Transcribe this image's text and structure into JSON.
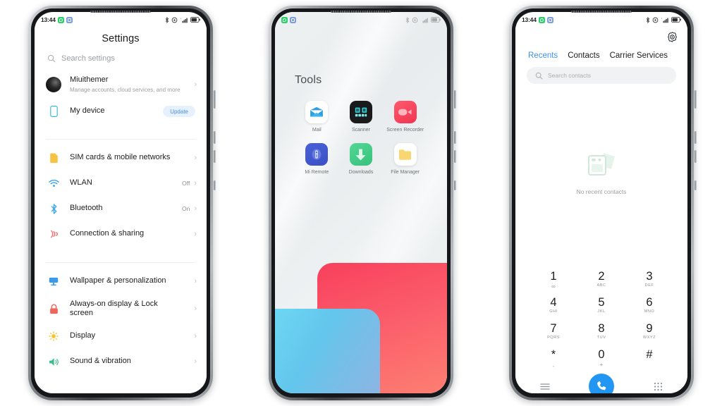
{
  "meta": {
    "accent_blue": "#3f90e8",
    "call_button_color": "#2196f3",
    "update_badge_color": "#4a90d9"
  },
  "status_bar": {
    "time": "13:44",
    "left_icons": [
      "whatsapp-icon",
      "blue-app-icon"
    ],
    "right_icons": [
      "bluetooth-icon",
      "alarm-icon",
      "signal-icon",
      "battery-icon"
    ]
  },
  "phone1_settings": {
    "title": "Settings",
    "search": {
      "placeholder": "Search settings",
      "icon": "search-icon"
    },
    "account": {
      "name": "Miuithemer",
      "subtitle": "Manage accounts, cloud services, and more",
      "avatar": "avatar"
    },
    "device": {
      "label": "My device",
      "badge": "Update",
      "icon": "phone-outline-icon"
    },
    "group_network": [
      {
        "label": "SIM cards & mobile networks",
        "value": "",
        "icon": "sim-card-icon"
      },
      {
        "label": "WLAN",
        "value": "Off",
        "icon": "wifi-icon"
      },
      {
        "label": "Bluetooth",
        "value": "On",
        "icon": "bluetooth-icon"
      },
      {
        "label": "Connection & sharing",
        "value": "",
        "icon": "connection-sharing-icon"
      }
    ],
    "group_personal": [
      {
        "label": "Wallpaper & personalization",
        "value": "",
        "icon": "wallpaper-icon"
      },
      {
        "label": "Always-on display & Lock screen",
        "value": "",
        "icon": "lock-icon"
      },
      {
        "label": "Display",
        "value": "",
        "icon": "brightness-icon"
      },
      {
        "label": "Sound & vibration",
        "value": "",
        "icon": "speaker-icon"
      }
    ],
    "chevron": "›"
  },
  "phone2_home": {
    "folder_title": "Tools",
    "apps": [
      {
        "name": "Mail",
        "icon": "mail-icon"
      },
      {
        "name": "Scanner",
        "icon": "scanner-icon"
      },
      {
        "name": "Screen Recorder",
        "icon": "screen-recorder-icon"
      },
      {
        "name": "Mi Remote",
        "icon": "mi-remote-icon"
      },
      {
        "name": "Downloads",
        "icon": "downloads-icon"
      },
      {
        "name": "File Manager",
        "icon": "file-manager-icon"
      }
    ]
  },
  "phone3_dialer": {
    "settings_icon": "gear-icon",
    "tabs": [
      {
        "label": "Recents",
        "active": true
      },
      {
        "label": "Contacts",
        "active": false
      },
      {
        "label": "Carrier Services",
        "active": false
      }
    ],
    "search": {
      "placeholder": "Search contacts",
      "icon": "search-icon"
    },
    "empty_state": {
      "text": "No recent contacts",
      "art": "no-contacts-illustration"
    },
    "keypad": [
      {
        "num": "1",
        "sub": "∞"
      },
      {
        "num": "2",
        "sub": "ABC"
      },
      {
        "num": "3",
        "sub": "DEF"
      },
      {
        "num": "4",
        "sub": "GHI"
      },
      {
        "num": "5",
        "sub": "JKL"
      },
      {
        "num": "6",
        "sub": "MNO"
      },
      {
        "num": "7",
        "sub": "PQRS"
      },
      {
        "num": "8",
        "sub": "TUV"
      },
      {
        "num": "9",
        "sub": "WXYZ"
      },
      {
        "num": "*",
        "sub": ","
      },
      {
        "num": "0",
        "sub": "+"
      },
      {
        "num": "#",
        "sub": ""
      }
    ],
    "bottom_bar": {
      "left_icon": "menu-lines-icon",
      "call_icon": "phone-call-icon",
      "right_icon": "keypad-grid-icon"
    }
  }
}
